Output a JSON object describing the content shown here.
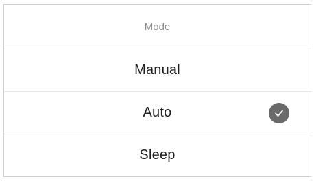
{
  "dialog": {
    "title": "Mode",
    "options": [
      {
        "label": "Manual",
        "selected": false
      },
      {
        "label": "Auto",
        "selected": true
      },
      {
        "label": "Sleep",
        "selected": false
      }
    ],
    "selected_icon": "check-circle-icon",
    "colors": {
      "title": "#8d8d8d",
      "option_text": "#1f1f1f",
      "check_circle": "#6a6a6a",
      "divider": "#e3e3e3"
    }
  }
}
